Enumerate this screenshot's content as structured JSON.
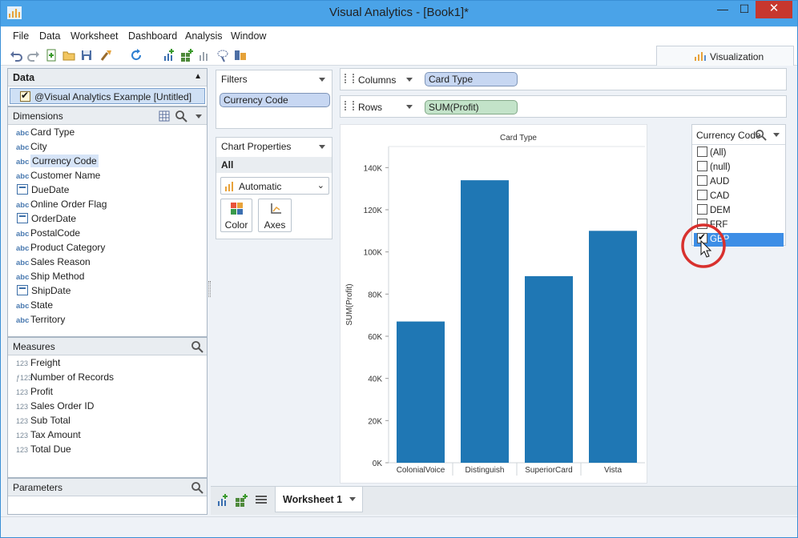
{
  "window": {
    "title": "Visual Analytics - [Book1]*",
    "min": "—",
    "max": "☐",
    "close": "✕"
  },
  "menu": [
    "File",
    "Data",
    "Worksheet",
    "Dashboard",
    "Analysis",
    "Window"
  ],
  "viz_tab": {
    "label": "Visualization"
  },
  "data_panel": {
    "header": "Data",
    "source": "@Visual Analytics Example [Untitled]"
  },
  "dimensions": {
    "header": "Dimensions",
    "items": [
      {
        "icon": "abc",
        "label": "Card Type"
      },
      {
        "icon": "abc",
        "label": "City"
      },
      {
        "icon": "abc",
        "label": "Currency Code"
      },
      {
        "icon": "abc",
        "label": "Customer Name"
      },
      {
        "icon": "date",
        "label": "DueDate"
      },
      {
        "icon": "abc",
        "label": "Online Order Flag"
      },
      {
        "icon": "date",
        "label": "OrderDate"
      },
      {
        "icon": "abc",
        "label": "PostalCode"
      },
      {
        "icon": "abc",
        "label": "Product Category"
      },
      {
        "icon": "abc",
        "label": "Sales Reason"
      },
      {
        "icon": "abc",
        "label": "Ship Method"
      },
      {
        "icon": "date",
        "label": "ShipDate"
      },
      {
        "icon": "abc",
        "label": "State"
      },
      {
        "icon": "abc",
        "label": "Territory"
      }
    ]
  },
  "measures": {
    "header": "Measures",
    "items": [
      {
        "icon": "123",
        "label": "Freight"
      },
      {
        "icon": "f123",
        "label": "Number of Records"
      },
      {
        "icon": "123",
        "label": "Profit"
      },
      {
        "icon": "123",
        "label": "Sales Order ID"
      },
      {
        "icon": "123",
        "label": "Sub Total"
      },
      {
        "icon": "123",
        "label": "Tax Amount"
      },
      {
        "icon": "123",
        "label": "Total Due"
      }
    ]
  },
  "parameters": {
    "header": "Parameters"
  },
  "filters": {
    "header": "Filters",
    "pill": "Currency Code"
  },
  "chart_properties": {
    "header": "Chart Properties",
    "tab": "All",
    "mark_type": "Automatic",
    "color_label": "Color",
    "axes_label": "Axes"
  },
  "shelves": {
    "columns_label": "Columns",
    "columns_pill": "Card Type",
    "rows_label": "Rows",
    "rows_pill": "SUM(Profit)"
  },
  "currency_filter": {
    "title": "Currency Code",
    "options": [
      {
        "label": "(All)",
        "checked": false
      },
      {
        "label": "(null)",
        "checked": false
      },
      {
        "label": "AUD",
        "checked": false
      },
      {
        "label": "CAD",
        "checked": false
      },
      {
        "label": "DEM",
        "checked": false
      },
      {
        "label": "FRF",
        "checked": false
      },
      {
        "label": "GBP",
        "checked": true
      }
    ],
    "highlight_color": "#3d8ee6"
  },
  "worksheet_tab": {
    "label": "Worksheet 1"
  },
  "colors": {
    "bar": "#1f77b4",
    "highlight_ring": "#d8312e"
  },
  "chart_data": {
    "type": "bar",
    "title": "Card Type",
    "ylabel": "SUM(Profit)",
    "categories": [
      "ColonialVoice",
      "Distinguish",
      "SuperiorCard",
      "Vista"
    ],
    "values": [
      67000,
      134000,
      88500,
      110000
    ],
    "ylim": [
      0,
      150000
    ],
    "yticks": [
      0,
      20000,
      40000,
      60000,
      80000,
      100000,
      120000,
      140000
    ],
    "ytick_labels": [
      "0K",
      "20K",
      "40K",
      "60K",
      "80K",
      "100K",
      "120K",
      "140K"
    ]
  }
}
